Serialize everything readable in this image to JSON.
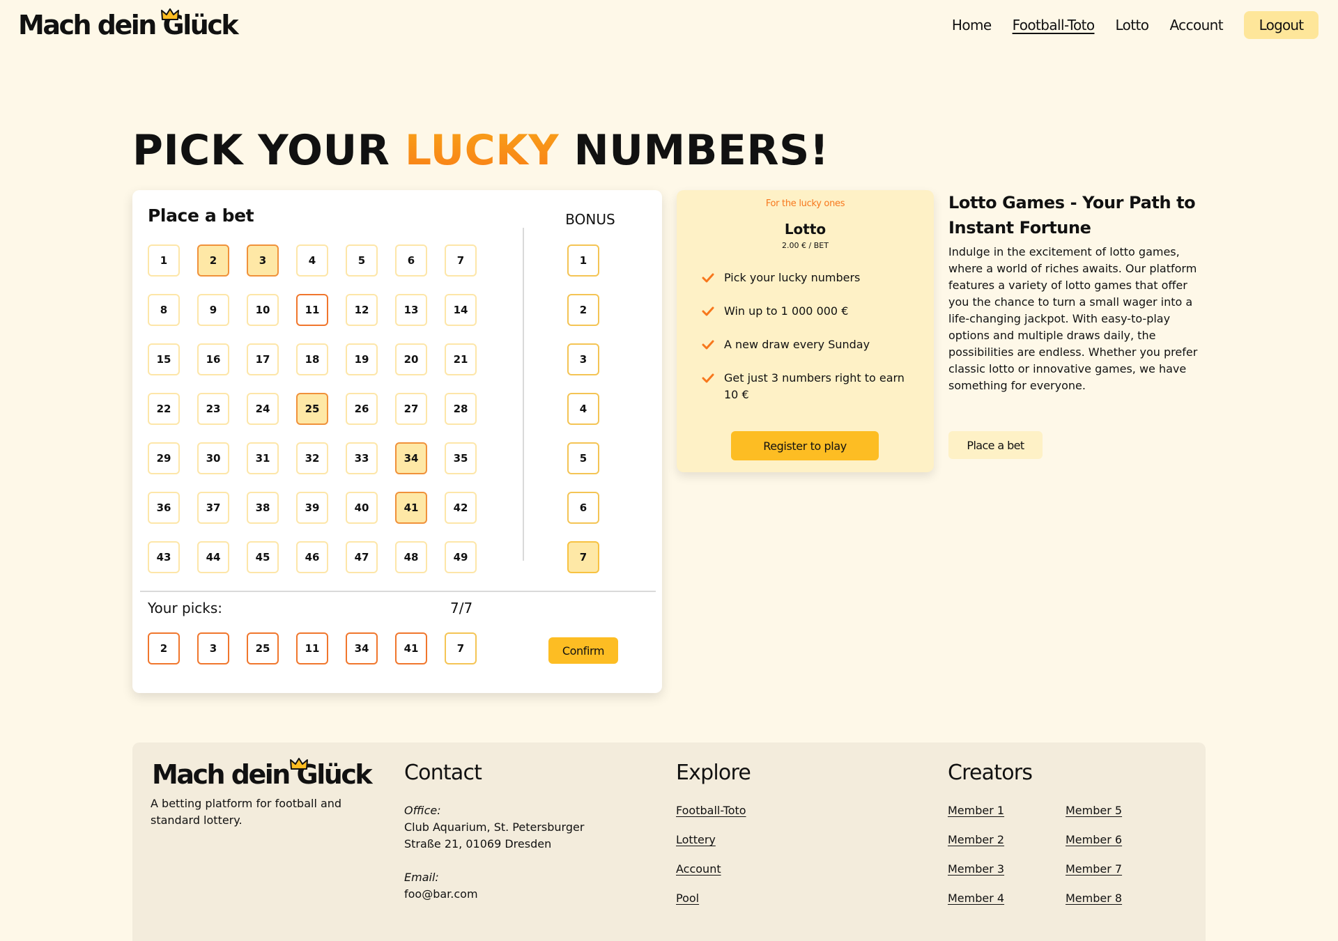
{
  "header": {
    "logo": "Mach dein Glück",
    "nav": [
      {
        "label": "Home",
        "active": false
      },
      {
        "label": "Football-Toto",
        "active": true
      },
      {
        "label": "Lotto",
        "active": false
      },
      {
        "label": "Account",
        "active": false
      }
    ],
    "logout_label": "Logout"
  },
  "hero": {
    "title_part1": "PICK YOUR ",
    "title_accent": "LUCKY",
    "title_part2": " NUMBERS!"
  },
  "bet": {
    "title": "Place a bet",
    "bonus_title": "BONUS",
    "numbers": [
      1,
      2,
      3,
      4,
      5,
      6,
      7,
      8,
      9,
      10,
      11,
      12,
      13,
      14,
      15,
      16,
      17,
      18,
      19,
      20,
      21,
      22,
      23,
      24,
      25,
      26,
      27,
      28,
      29,
      30,
      31,
      32,
      33,
      34,
      35,
      36,
      37,
      38,
      39,
      40,
      41,
      42,
      43,
      44,
      45,
      46,
      47,
      48,
      49
    ],
    "picked_numbers": [
      2,
      3,
      25,
      34,
      41
    ],
    "latest_pick": 11,
    "bonus_numbers": [
      1,
      2,
      3,
      4,
      5,
      6,
      7
    ],
    "bonus_picked": 7,
    "picks_label": "Your picks:",
    "picks_count": "7/7",
    "picks": [
      {
        "value": "2",
        "bonus": false
      },
      {
        "value": "3",
        "bonus": false
      },
      {
        "value": "25",
        "bonus": false
      },
      {
        "value": "11",
        "bonus": false
      },
      {
        "value": "34",
        "bonus": false
      },
      {
        "value": "41",
        "bonus": false
      },
      {
        "value": "7",
        "bonus": true
      }
    ],
    "confirm_label": "Confirm"
  },
  "pricing": {
    "eyebrow": "For the lucky ones",
    "title": "Lotto",
    "price": "2.00 € / BET",
    "features": [
      "Pick your lucky numbers",
      "Win up to 1 000 000 €",
      "A new draw every Sunday",
      "Get just 3 numbers right to earn 10 €"
    ],
    "register_label": "Register to play"
  },
  "info": {
    "title": "Lotto Games - Your Path to Instant Fortune",
    "body": "Indulge in the excitement of lotto games, where a world of riches awaits. Our platform features a variety of lotto games that offer you the chance to turn a small wager into a life-changing jackpot. With easy-to-play options and multiple draws daily, the possibilities are endless. Whether you prefer classic lotto or innovative games, we have something for everyone.",
    "place_bet_label": "Place a bet"
  },
  "footer": {
    "logo": "Mach dein Glück",
    "tagline": "A betting platform for football and standard lottery.",
    "contact_title": "Contact",
    "office_label": "Office:",
    "office_address": "Club Aquarium, St. Petersburger Straße 21, 01069 Dresden",
    "email_label": "Email:",
    "email": "foo@bar.com",
    "explore_title": "Explore",
    "explore_links": [
      "Football-Toto",
      "Lottery",
      "Account",
      "Pool"
    ],
    "creators_title": "Creators",
    "creators": [
      "Member 1",
      "Member 2",
      "Member 3",
      "Member 4",
      "Member 5",
      "Member 6",
      "Member 7",
      "Member 8"
    ]
  },
  "colors": {
    "background": "#fef8e8",
    "accent_orange": "#f9921a",
    "button_yellow": "#fdbd23",
    "card_yellow": "#fef1c6",
    "footer_bg": "#f3ecdc"
  }
}
